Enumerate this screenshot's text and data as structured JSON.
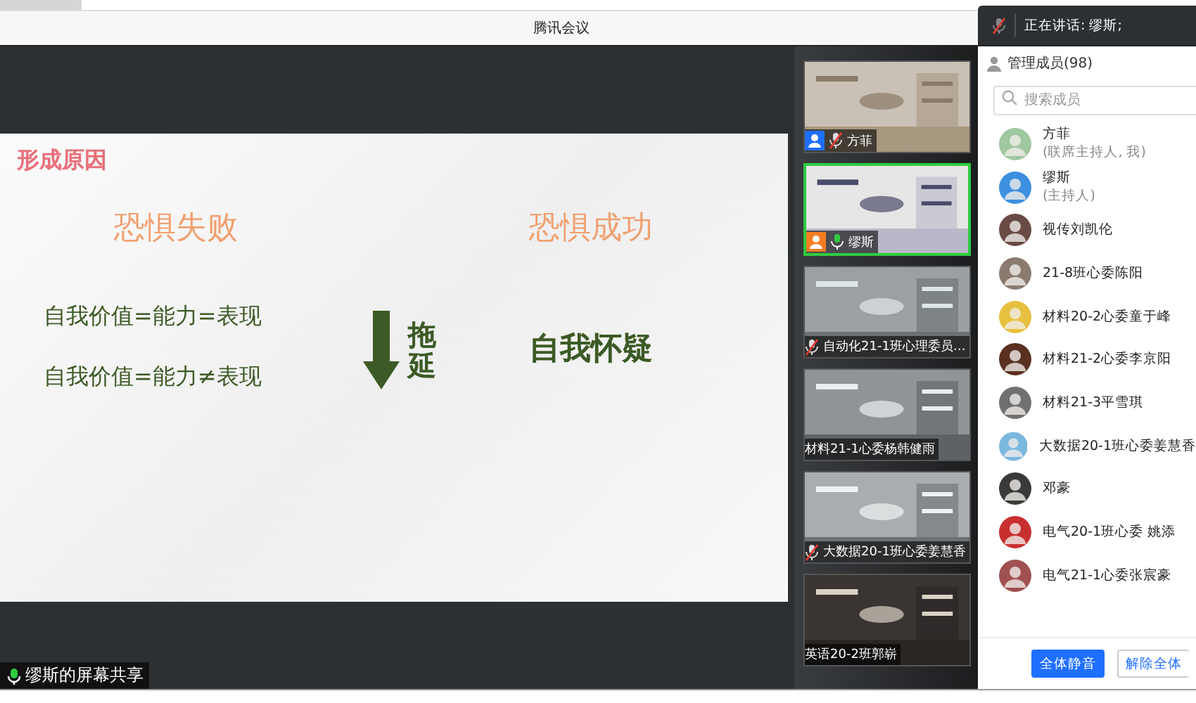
{
  "window": {
    "title": "腾讯会议"
  },
  "speaking": {
    "label": "正在讲话: 缪斯;"
  },
  "share": {
    "label": "缪斯的屏幕共享",
    "slide": {
      "title": "形成原因",
      "left_heading": "恐惧失败",
      "right_heading": "恐惧成功",
      "statements": [
        "自我价值=能力=表现",
        "自我价值=能力≠表现"
      ],
      "arrow_label": "拖延",
      "right_text": "自我怀疑"
    }
  },
  "videos": [
    {
      "name": "方菲",
      "muted": true,
      "color": "#1e6fff",
      "selected": false
    },
    {
      "name": "缪斯",
      "muted": false,
      "color": "#f57c1f",
      "selected": true
    },
    {
      "name": "自动化21-1班心理委员…",
      "muted": true,
      "selected": false
    },
    {
      "name": "材料21-1心委杨韩健雨",
      "selected": false
    },
    {
      "name": "大数据20-1班心委姜慧香",
      "muted": true,
      "selected": false
    },
    {
      "name": "英语20-2班郭崭",
      "selected": false
    }
  ],
  "members_panel": {
    "title": "管理成员(98)",
    "search": {
      "placeholder": "搜索成员"
    },
    "members": [
      {
        "name": "方菲",
        "role": "(联席主持人, 我)",
        "color": "#9fc7a0"
      },
      {
        "name": "缪斯",
        "role": "(主持人)",
        "color": "#3d8fe0"
      },
      {
        "name": "视传刘凯伦",
        "color": "#6a4a44"
      },
      {
        "name": "21-8班心委陈阳",
        "color": "#8a7a70"
      },
      {
        "name": "材料20-2心委童于峰",
        "color": "#e8c040"
      },
      {
        "name": "材料21-2心委李京阳",
        "color": "#5a3020"
      },
      {
        "name": "材料21-3平雪琪",
        "color": "#707070"
      },
      {
        "name": "大数据20-1班心委姜慧香",
        "color": "#7ab8e0"
      },
      {
        "name": "邓豪",
        "color": "#3a3a3a"
      },
      {
        "name": "电气20-1班心委 姚添",
        "color": "#c83030"
      },
      {
        "name": "电气21-1心委张宸豪",
        "color": "#a05050"
      }
    ],
    "buttons": [
      {
        "label": "全体静音",
        "kind": "primary"
      },
      {
        "label": "解除全体",
        "kind": "outline"
      }
    ]
  }
}
